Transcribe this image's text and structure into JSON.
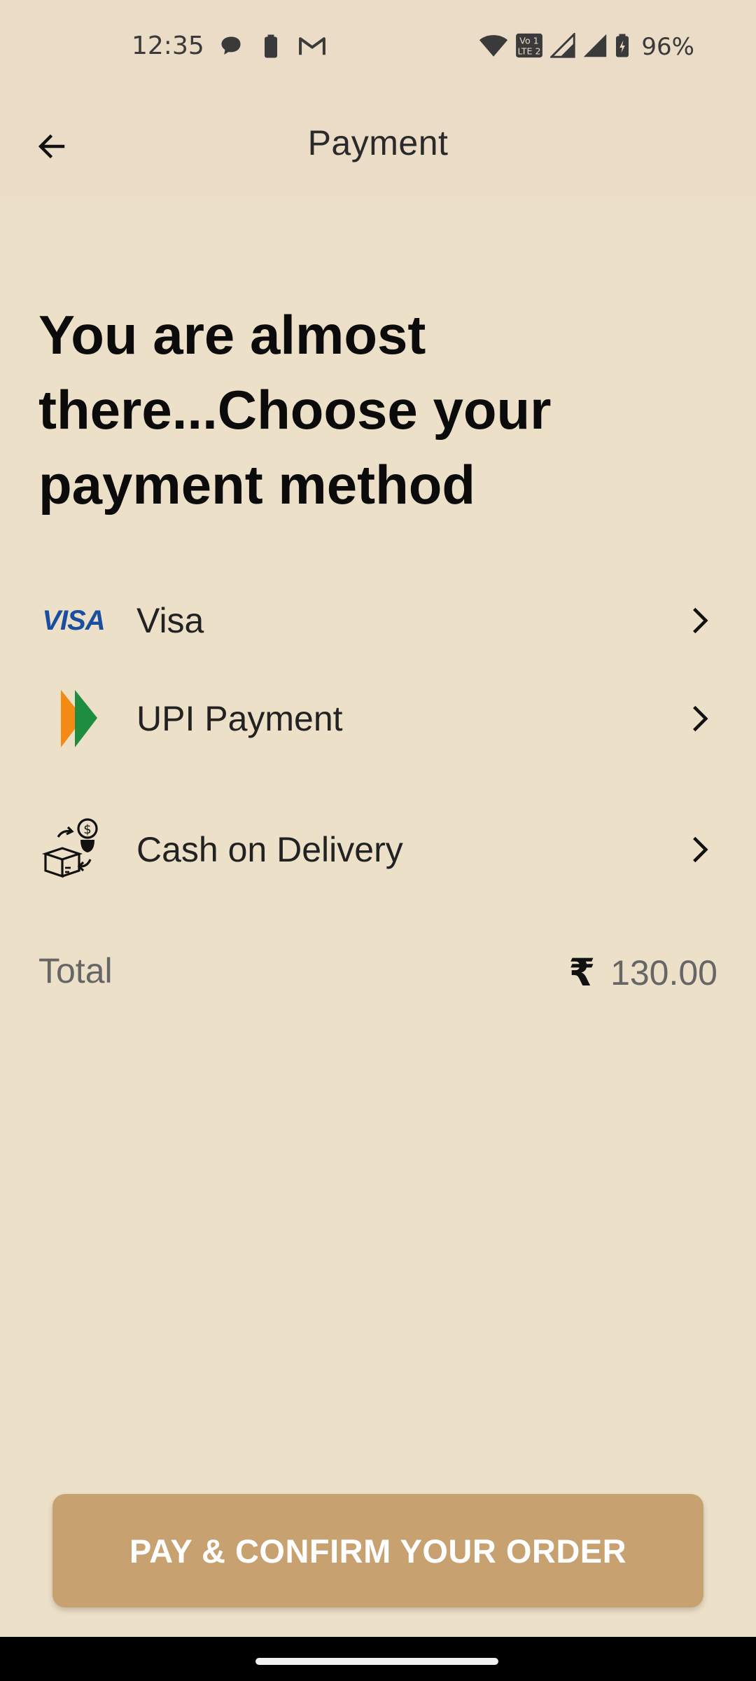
{
  "status_bar": {
    "time": "12:35",
    "battery": "96%",
    "icons": [
      "chat-bubble-icon",
      "battery-saver-icon",
      "gmail-icon",
      "wifi-icon",
      "volte-icon",
      "signal-icon",
      "signal-icon",
      "battery-icon"
    ]
  },
  "app_bar": {
    "title": "Payment",
    "back_icon": "arrow-left-icon"
  },
  "heading": "You are almost there...Choose your payment method",
  "payment_options": [
    {
      "label": "Visa",
      "icon": "visa-logo",
      "logo_text": "VISA"
    },
    {
      "label": "UPI Payment",
      "icon": "upi-logo"
    },
    {
      "label": "Cash on Delivery",
      "icon": "cash-on-delivery-icon"
    }
  ],
  "total": {
    "label": "Total",
    "currency_symbol": "₹",
    "amount": "130.00"
  },
  "pay_button": {
    "label": "PAY & CONFIRM YOUR ORDER"
  },
  "colors": {
    "background": "#ede0c8",
    "button": "#c8a171",
    "visa_blue": "#1a4fa0"
  }
}
